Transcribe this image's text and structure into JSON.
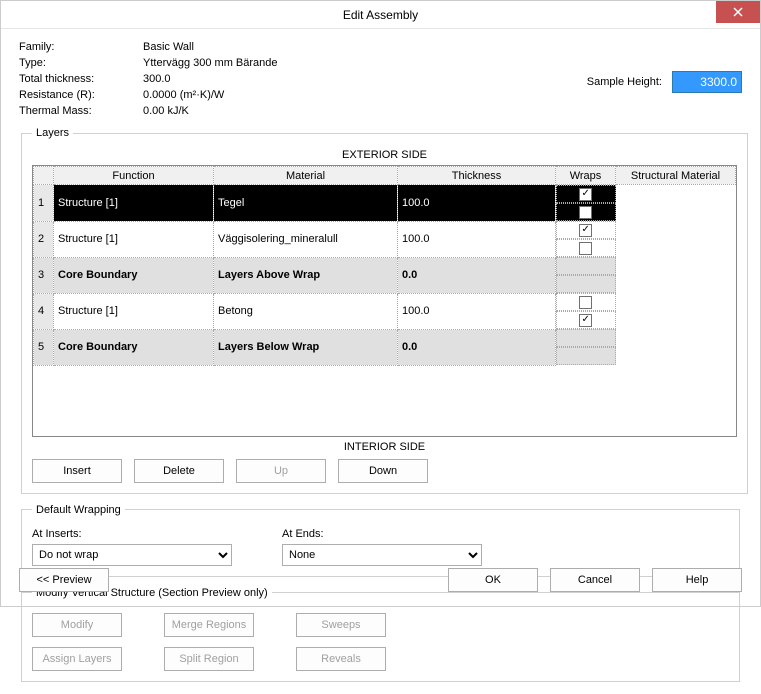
{
  "window": {
    "title": "Edit Assembly"
  },
  "props": {
    "family_label": "Family:",
    "family_value": "Basic Wall",
    "type_label": "Type:",
    "type_value": "Yttervägg 300 mm Bärande",
    "thick_label": "Total thickness:",
    "thick_value": "300.0",
    "res_label": "Resistance (R):",
    "res_value": "0.0000 (m²·K)/W",
    "mass_label": "Thermal Mass:",
    "mass_value": "0.00 kJ/K"
  },
  "sample": {
    "label": "Sample Height:",
    "value": "3300.0"
  },
  "layers": {
    "legend": "Layers",
    "ext": "EXTERIOR SIDE",
    "int": "INTERIOR SIDE",
    "cols": {
      "fn": "Function",
      "mat": "Material",
      "th": "Thickness",
      "wr": "Wraps",
      "sm": "Structural Material"
    },
    "rows": [
      {
        "n": "1",
        "fn": "Structure [1]",
        "mat": "Tegel",
        "th": "100.0",
        "wraps": true,
        "sm": false,
        "sel": true
      },
      {
        "n": "2",
        "fn": "Structure [1]",
        "mat": "Väggisolering_mineralull",
        "th": "100.0",
        "wraps": true,
        "sm": false
      },
      {
        "n": "3",
        "fn": "Core Boundary",
        "mat": "Layers Above Wrap",
        "th": "0.0",
        "core": true
      },
      {
        "n": "4",
        "fn": "Structure [1]",
        "mat": "Betong",
        "th": "100.0",
        "wraps": false,
        "sm": true
      },
      {
        "n": "5",
        "fn": "Core Boundary",
        "mat": "Layers Below Wrap",
        "th": "0.0",
        "core": true
      }
    ],
    "buttons": {
      "insert": "Insert",
      "delete": "Delete",
      "up": "Up",
      "down": "Down"
    }
  },
  "wrap": {
    "legend": "Default Wrapping",
    "inserts_label": "At Inserts:",
    "inserts_value": "Do not wrap",
    "ends_label": "At Ends:",
    "ends_value": "None"
  },
  "mvs": {
    "legend": "Modify Vertical Structure (Section Preview only)",
    "modify": "Modify",
    "merge": "Merge Regions",
    "sweeps": "Sweeps",
    "assign": "Assign Layers",
    "split": "Split Region",
    "reveals": "Reveals"
  },
  "footer": {
    "preview": "<< Preview",
    "ok": "OK",
    "cancel": "Cancel",
    "help": "Help"
  }
}
